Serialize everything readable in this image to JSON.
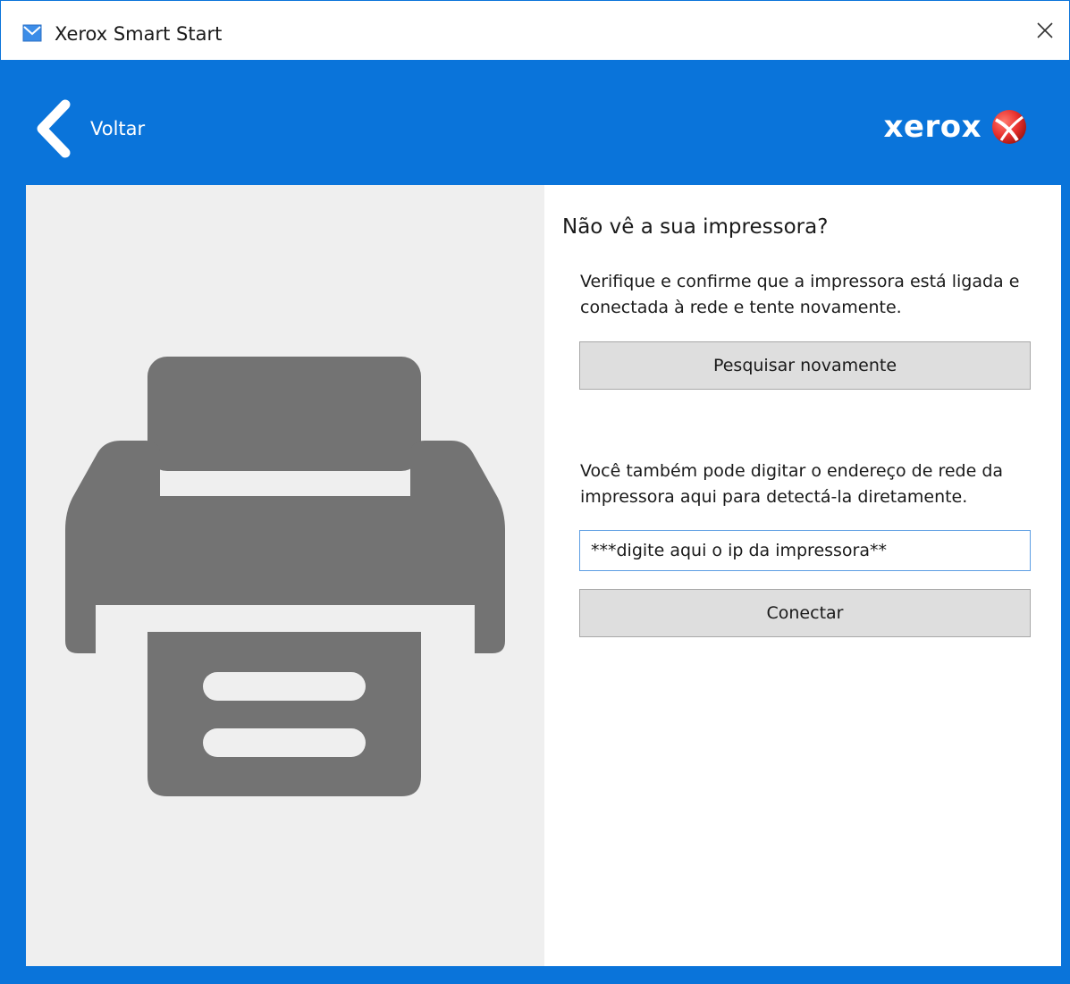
{
  "window": {
    "title": "Xerox Smart Start",
    "close_icon": "close-icon",
    "app_icon": "xerox-envelope-icon"
  },
  "header": {
    "back_label": "Voltar",
    "logo_text": "xerox",
    "colors": {
      "header_bg": "#0a74da",
      "logo_ball": "#e8312e"
    }
  },
  "main": {
    "illustration_icon": "printer-icon",
    "heading": "Não vê a sua impressora?",
    "check_text": "Verifique e confirme que a impressora está ligada e conectada à rede e tente novamente.",
    "search_again_label": "Pesquisar novamente",
    "manual_text": "Você também pode digitar o endereço de rede da impressora aqui para detectá-la diretamente.",
    "ip_input_value": "***digite aqui o ip da impressora**",
    "connect_label": "Conectar"
  }
}
